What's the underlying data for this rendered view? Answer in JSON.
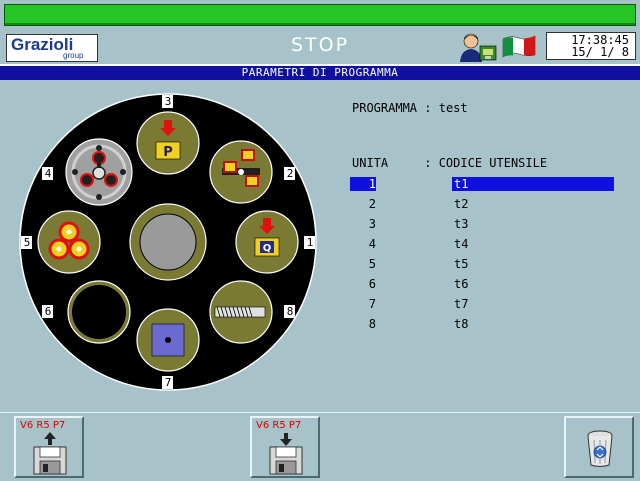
{
  "header": {
    "logo_name": "Grazioli",
    "logo_sub": "group",
    "status": "STOP",
    "time": "17:38:45",
    "date": "15/ 1/ 8"
  },
  "title": "PARAMETRI DI PROGRAMMA",
  "program": {
    "label": "PROGRAMMA",
    "value": "test"
  },
  "table": {
    "col_unit": "UNITA",
    "col_code": ": CODICE UTENSILE",
    "rows": [
      {
        "unit": "1",
        "code": "t1",
        "selected": true
      },
      {
        "unit": "2",
        "code": "t2"
      },
      {
        "unit": "3",
        "code": "t3"
      },
      {
        "unit": "4",
        "code": "t4"
      },
      {
        "unit": "5",
        "code": "t5"
      },
      {
        "unit": "6",
        "code": "t6"
      },
      {
        "unit": "7",
        "code": "t7"
      },
      {
        "unit": "8",
        "code": "t8"
      }
    ]
  },
  "turret": {
    "positions": [
      "1",
      "2",
      "3",
      "4",
      "5",
      "6",
      "7",
      "8"
    ]
  },
  "buttons": {
    "save_label": "V6 R5 P7",
    "load_label": "V6 R5 P7"
  },
  "colors": {
    "background": "#a7c3c9",
    "title_bar": "#1010a0",
    "selection": "#1010e0",
    "status_bar": "#25c525",
    "station_fill": "#7a7a34"
  },
  "icons": {
    "operator": "operator-icon",
    "language": "italian-flag-icon",
    "save": "floppy-save-icon",
    "load": "floppy-load-icon",
    "delete": "trash-icon"
  }
}
